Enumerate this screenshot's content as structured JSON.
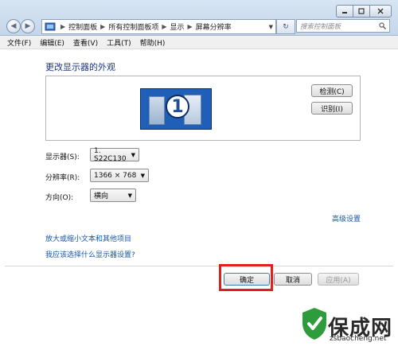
{
  "titlebar": {
    "address_segments": [
      "控制面板",
      "所有控制面板项",
      "显示",
      "屏幕分辨率"
    ],
    "search_placeholder": "搜索控制面板"
  },
  "menu": [
    "文件(F)",
    "编辑(E)",
    "查看(V)",
    "工具(T)",
    "帮助(H)"
  ],
  "main": {
    "heading": "更改显示器的外观",
    "monitor_number": "1",
    "detect_label": "检测(C)",
    "identify_label": "识别(I)",
    "display_label": "显示器(S):",
    "display_value": "1. S22C130",
    "resolution_label": "分辨率(R):",
    "resolution_value": "1366 × 768",
    "orientation_label": "方向(O):",
    "orientation_value": "横向",
    "advanced_link": "高级设置",
    "link_text_size": "放大或缩小文本和其他项目",
    "link_help": "我应该选择什么显示器设置?"
  },
  "footer": {
    "ok_label": "确定",
    "cancel_label": "取消",
    "apply_label": "应用(A)"
  },
  "watermark": {
    "text": "保成网",
    "url": "zsbaocheng.net"
  },
  "colors": {
    "highlight": "#e0201c",
    "link": "#1656a8",
    "heading": "#1e3287"
  }
}
